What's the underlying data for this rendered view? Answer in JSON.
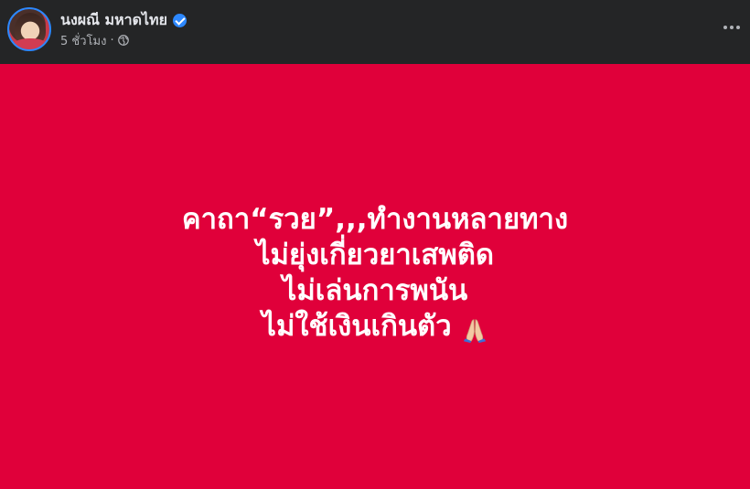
{
  "post": {
    "author_name": "นงผณี มหาดไทย",
    "verified_icon": "verified-badge-icon",
    "timestamp": "5 ชั่วโมง",
    "separator": "·",
    "privacy_icon": "globe-icon",
    "more_icon": "more-options-icon",
    "status_lines": [
      "คาถา“รวย”,,,ทำงานหลายทาง",
      "ไม่ยุ่งเกี่ยวยาเสพติด",
      "ไม่เล่นการพนัน",
      "ไม่ใช้เงินเกินตัว"
    ],
    "status_emoji_icon": "folded-hands-icon",
    "colors": {
      "header_bg": "#242526",
      "status_bg": "#e0003a",
      "accent": "#2d88ff",
      "text_primary": "#e4e6eb",
      "text_secondary": "#b0b3b8"
    }
  }
}
